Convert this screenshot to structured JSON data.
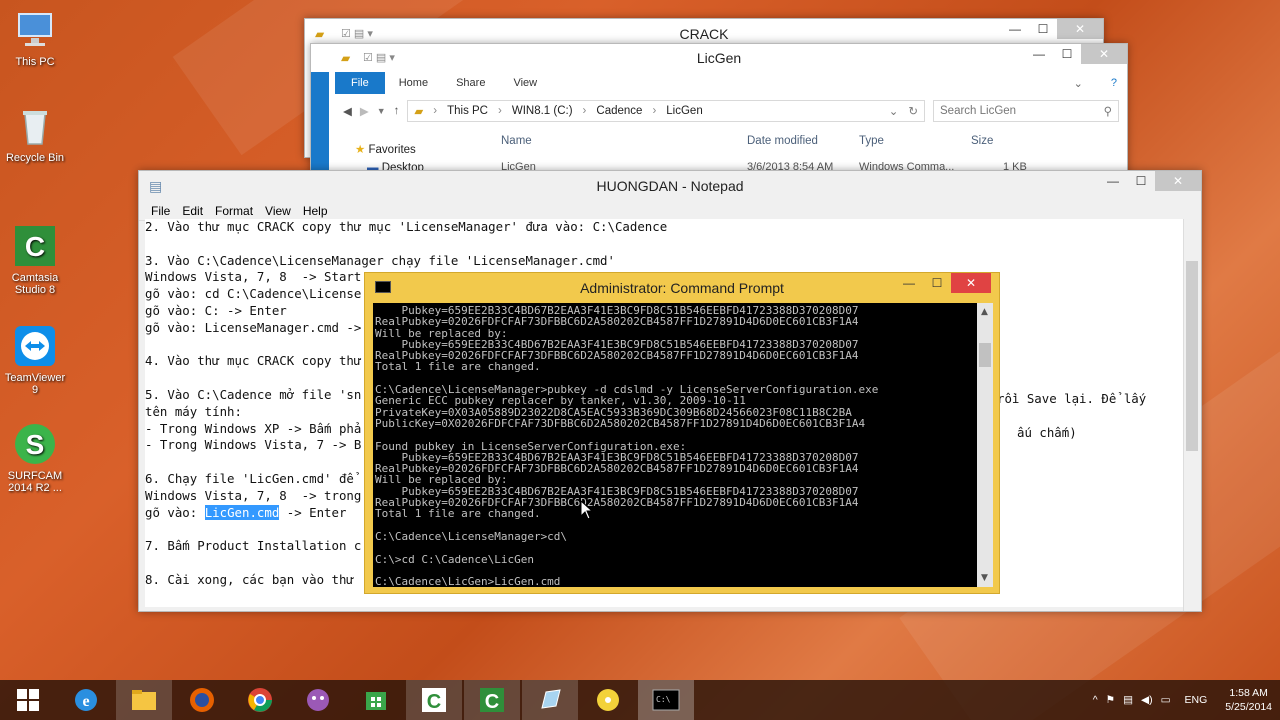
{
  "desktop": {
    "icons": [
      {
        "label": "This PC",
        "icon": "computer-icon"
      },
      {
        "label": "Recycle Bin",
        "icon": "recycle-bin-icon"
      },
      {
        "label": "Camtasia\nStudio 8",
        "icon": "camtasia-icon"
      },
      {
        "label": "TeamViewer\n9",
        "icon": "teamviewer-icon"
      },
      {
        "label": "SURFCAM\n2014 R2 ...",
        "icon": "surfcam-icon"
      }
    ]
  },
  "crack_window": {
    "title": "CRACK"
  },
  "licgen_window": {
    "title": "LicGen",
    "ribbon": {
      "file": "File",
      "home": "Home",
      "share": "Share",
      "view": "View"
    },
    "breadcrumb": [
      "This PC",
      "WIN8.1 (C:)",
      "Cadence",
      "LicGen"
    ],
    "search_placeholder": "Search LicGen",
    "columns": {
      "name": "Name",
      "date": "Date modified",
      "type": "Type",
      "size": "Size"
    },
    "nav": {
      "favorites": "Favorites",
      "desktop": "Desktop"
    },
    "row": {
      "name": "LicGen",
      "date": "3/6/2013 8:54 AM",
      "type": "Windows Comma...",
      "size": "1 KB"
    }
  },
  "notepad": {
    "title": "HUONGDAN - Notepad",
    "menu": [
      "File",
      "Edit",
      "Format",
      "View",
      "Help"
    ],
    "lines": [
      "2. Vào thư mục CRACK copy thư mục 'LicenseManager' đưa vào: C:\\Cadence",
      "",
      "3. Vào C:\\Cadence\\LicenseManager chạy file 'LicenseManager.cmd'",
      "Windows Vista, 7, 8  -> Start",
      "gõ vào: cd C:\\Cadence\\License",
      "gõ vào: C: -> Enter",
      "gõ vào: LicenseManager.cmd ->",
      "",
      "4. Vào thư mục CRACK copy thư",
      "",
      "5. Vào C:\\Cadence mở file 'sn",
      "tên máy tính:",
      "- Trong Windows XP -> Bấm phả",
      "- Trong Windows Vista, 7 -> B",
      "",
      "6. Chạy file 'LicGen.cmd' để",
      "Windows Vista, 7, 8  -> trong",
      "gõ vào: ",
      "",
      "7. Bấm Product Installation c",
      "",
      "8. Cài xong, các bạn vào thư"
    ],
    "selected": "LicGen.cmd",
    "after_selected": " -> Enter",
    "right_text_1": "rồi Save lại. Để lấy",
    "right_text_2": "ấu chấm)"
  },
  "cmd": {
    "title": "Administrator: Command Prompt",
    "lines": [
      "    Pubkey=659EE2B33C4BD67B2EAA3F41E3BC9FD8C51B546EEBFD41723388D370208D07",
      "RealPubkey=02026FDFCFAF73DFBBC6D2A580202CB4587FF1D27891D4D6D0EC601CB3F1A4",
      "Will be replaced by:",
      "    Pubkey=659EE2B33C4BD67B2EAA3F41E3BC9FD8C51B546EEBFD41723388D370208D07",
      "RealPubkey=02026FDFCFAF73DFBBC6D2A580202CB4587FF1D27891D4D6D0EC601CB3F1A4",
      "Total 1 file are changed.",
      "",
      "C:\\Cadence\\LicenseManager>pubkey -d cdslmd -y LicenseServerConfiguration.exe",
      "Generic ECC pubkey replacer by tanker, v1.30, 2009-10-11",
      "PrivateKey=0X03A05889D23022D8CA5EAC5933B369DC309B68D24566023F08C11B8C2BA",
      "PublicKey=0X02026FDFCFAF73DFBBC6D2A580202CB4587FF1D27891D4D6D0EC601CB3F1A4",
      "",
      "Found pubkey in LicenseServerConfiguration.exe:",
      "    Pubkey=659EE2B33C4BD67B2EAA3F41E3BC9FD8C51B546EEBFD41723388D370208D07",
      "RealPubkey=02026FDFCFAF73DFBBC6D2A580202CB4587FF1D27891D4D6D0EC601CB3F1A4",
      "Will be replaced by:",
      "    Pubkey=659EE2B33C4BD67B2EAA3F41E3BC9FD8C51B546EEBFD41723388D370208D07",
      "RealPubkey=02026FDFCFAF73DFBBC6D2A580202CB4587FF1D27891D4D6D0EC601CB3F1A4",
      "Total 1 file are changed.",
      "",
      "C:\\Cadence\\LicenseManager>cd\\",
      "",
      "C:\\>cd C:\\Cadence\\LicGen",
      "",
      "C:\\Cadence\\LicGen>LicGen.cmd"
    ]
  },
  "taskbar": {
    "apps": [
      "start-icon",
      "ie-icon",
      "file-explorer-icon",
      "firefox-icon",
      "chrome-icon",
      "bonzi-icon",
      "store-icon",
      "camtasia-recorder-icon",
      "camtasia-studio-icon",
      "notepad-icon",
      "cd-icon",
      "cmd-icon"
    ],
    "lang": "ENG",
    "time": "1:58 AM",
    "date": "5/25/2014"
  }
}
